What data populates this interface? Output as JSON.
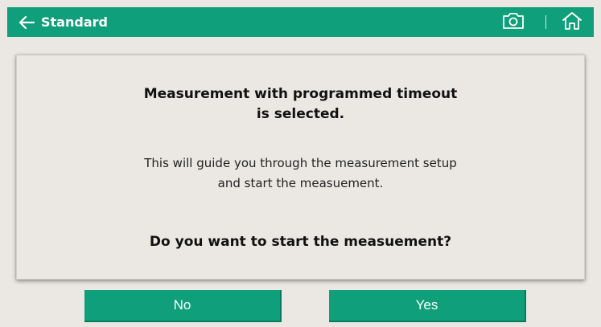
{
  "header": {
    "title": "Standard",
    "icons": {
      "back": "arrow-left-icon",
      "camera": "camera-icon",
      "home": "home-icon"
    }
  },
  "dialog": {
    "title_line1": "Measurement with programmed timeout",
    "title_line2": "is selected.",
    "body_line1": "This will guide you through the measurement setup",
    "body_line2": "and start the measuement.",
    "question": "Do you want to start the measuement?"
  },
  "buttons": {
    "no_label": "No",
    "yes_label": "Yes"
  },
  "colors": {
    "accent": "#0f9f7a",
    "background": "#ebe8e3"
  }
}
